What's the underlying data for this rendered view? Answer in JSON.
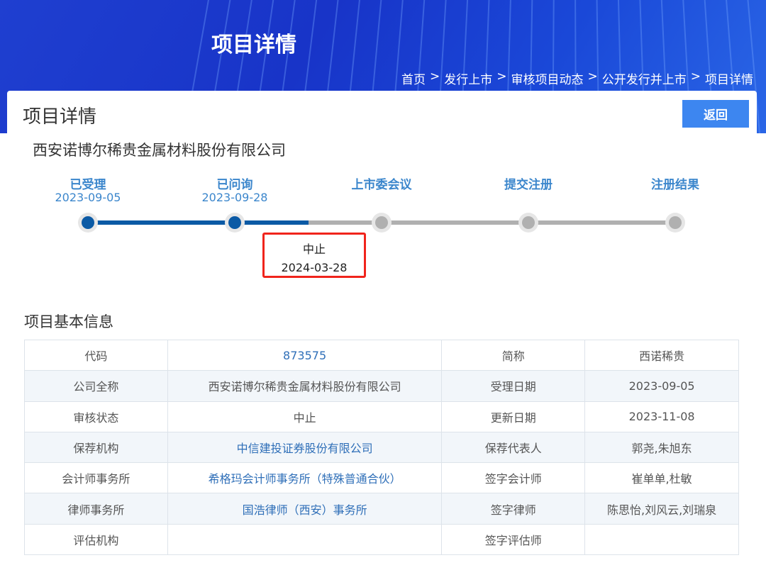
{
  "banner": {
    "title": "项目详情",
    "breadcrumb": [
      "首页",
      "发行上市",
      "审核项目动态",
      "公开发行并上市",
      "项目详情"
    ],
    "sep": ">"
  },
  "card": {
    "title": "项目详情",
    "back_label": "返回",
    "company": "西安诺博尔稀贵金属材料股份有限公司"
  },
  "steps": [
    {
      "label": "已受理",
      "date": "2023-09-05",
      "done": true
    },
    {
      "label": "已问询",
      "date": "2023-09-28",
      "done": true
    },
    {
      "label": "上市委会议",
      "date": "",
      "done": false
    },
    {
      "label": "提交注册",
      "date": "",
      "done": false
    },
    {
      "label": "注册结果",
      "date": "",
      "done": false
    }
  ],
  "status_tip": {
    "status": "中止",
    "date": "2024-03-28"
  },
  "section_title": "项目基本信息",
  "rows": [
    [
      "代码",
      "873575",
      "简称",
      "西诺稀贵"
    ],
    [
      "公司全称",
      "西安诺博尔稀贵金属材料股份有限公司",
      "受理日期",
      "2023-09-05"
    ],
    [
      "审核状态",
      "中止",
      "更新日期",
      "2023-11-08"
    ],
    [
      "保荐机构",
      "中信建投证券股份有限公司",
      "保荐代表人",
      "郭尧,朱旭东"
    ],
    [
      "会计师事务所",
      "希格玛会计师事务所（特殊普通合伙）",
      "签字会计师",
      "崔单单,杜敏"
    ],
    [
      "律师事务所",
      "国浩律师（西安）事务所",
      "签字律师",
      "陈思怡,刘风云,刘瑞泉"
    ],
    [
      "评估机构",
      "",
      "签字评估师",
      ""
    ]
  ],
  "link_cells": [
    [
      0,
      1
    ],
    [
      3,
      1
    ],
    [
      4,
      1
    ],
    [
      5,
      1
    ]
  ],
  "colors": {
    "accent": "#3d86f0",
    "done": "#0b5aa5",
    "pending": "#b0b0b0",
    "alert": "#f0241c"
  }
}
